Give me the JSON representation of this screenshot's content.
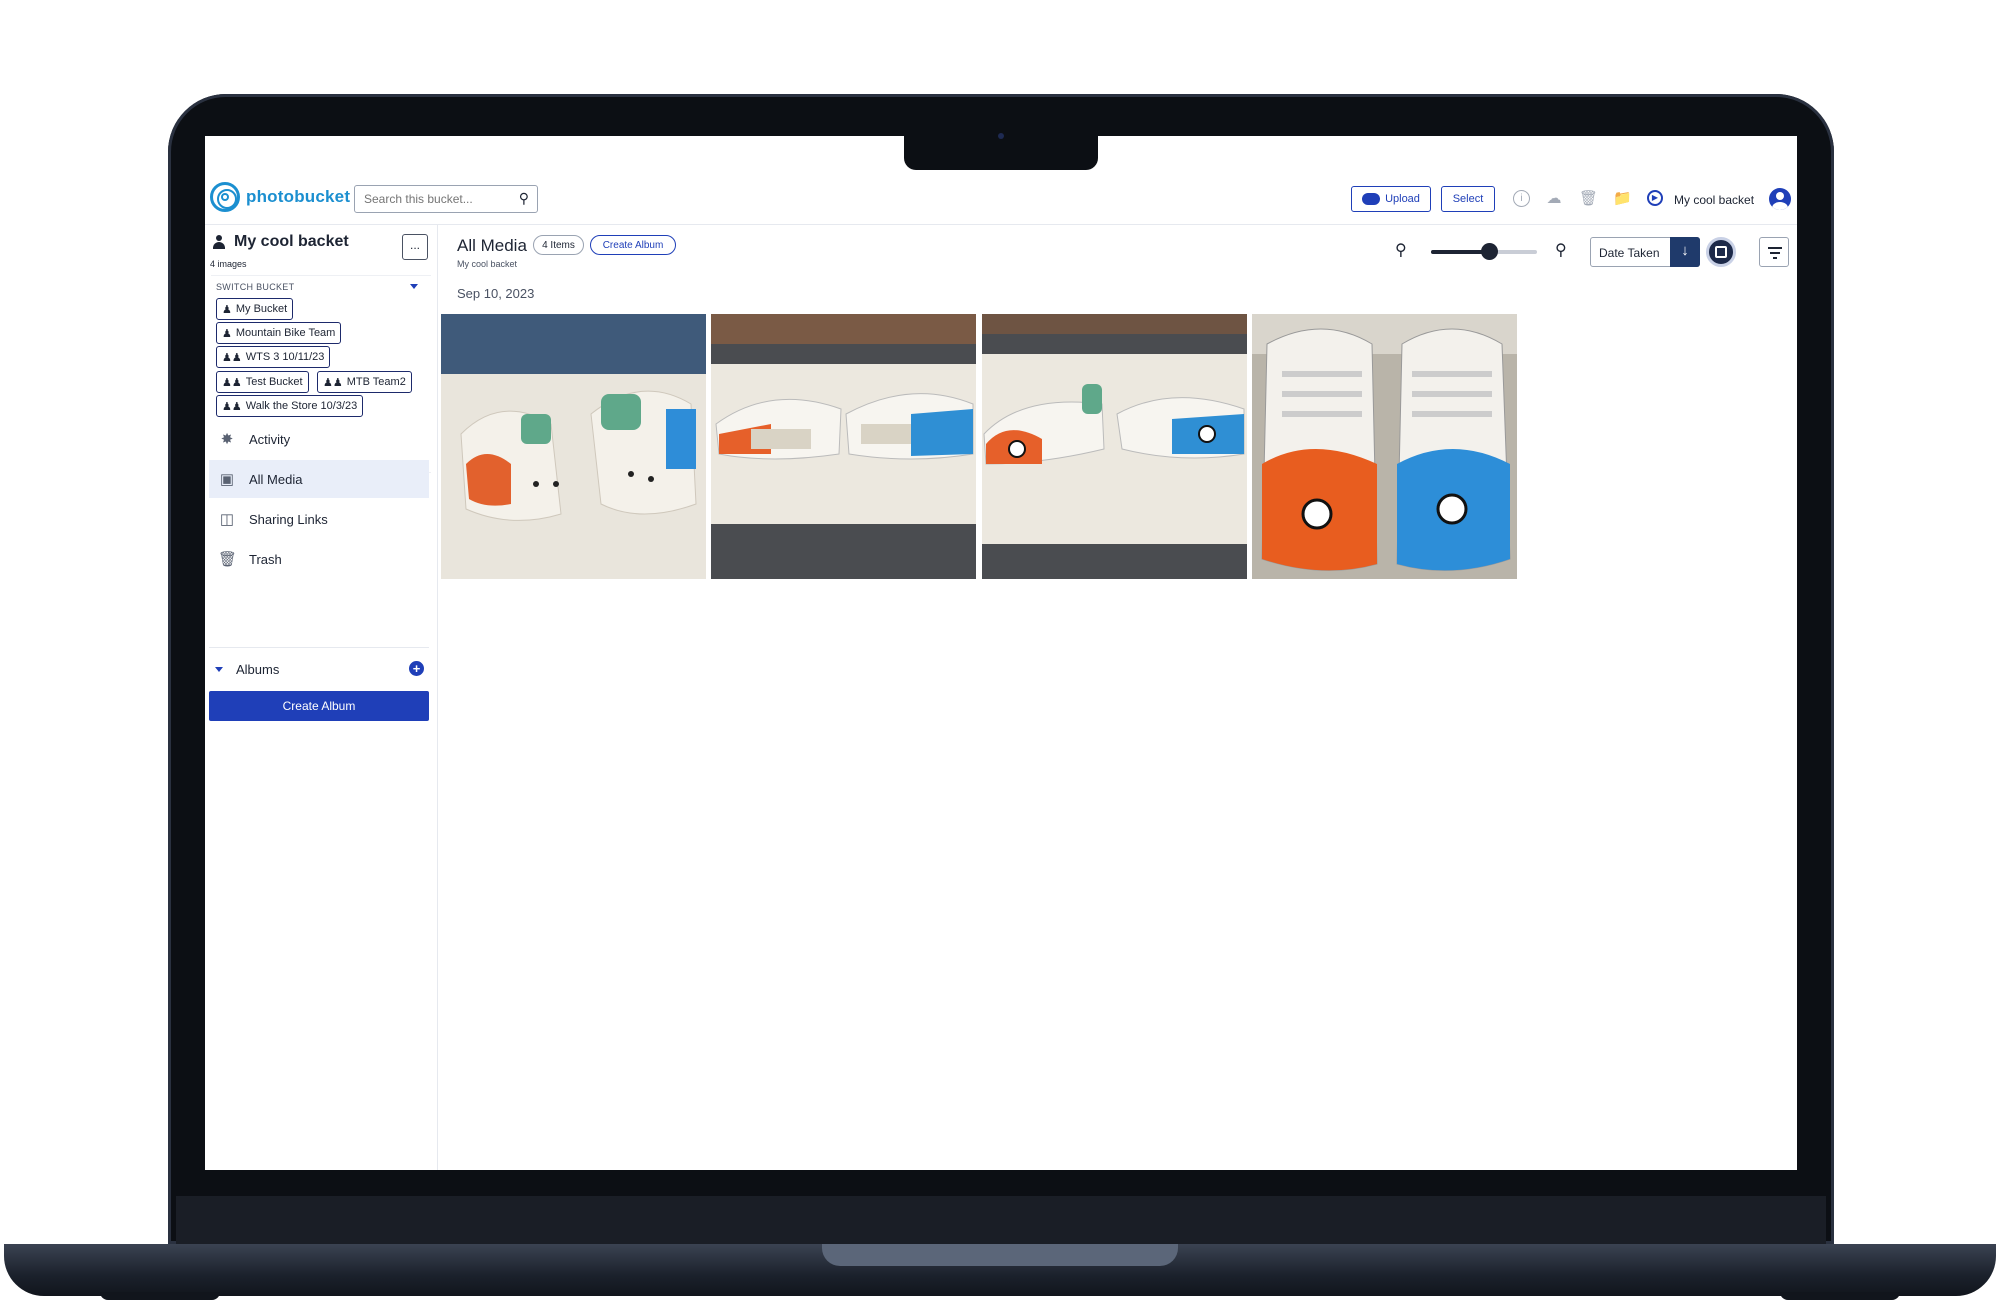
{
  "app": {
    "logo_text": "photobucket",
    "search_placeholder": "Search this bucket...",
    "upload_label": "Upload",
    "select_label": "Select",
    "bucket_name": "My cool backet"
  },
  "sidebar": {
    "title": "My cool backet",
    "image_count": "4 images",
    "more_label": "...",
    "switch_label": "SWITCH BUCKET",
    "buckets": [
      {
        "label": "My Bucket",
        "icon": "person-icon"
      },
      {
        "label": "Mountain Bike Team",
        "icon": "person-icon"
      },
      {
        "label": "WTS 3 10/11/23",
        "icon": "group-icon"
      },
      {
        "label": "Test Bucket",
        "icon": "group-icon"
      },
      {
        "label": "MTB Team2",
        "icon": "group-icon"
      },
      {
        "label": "Walk the Store 10/3/23",
        "icon": "group-icon"
      }
    ],
    "nav": [
      {
        "label": "Activity",
        "icon": "activity-icon"
      },
      {
        "label": "All Media",
        "icon": "media-icon",
        "active": true
      },
      {
        "label": "Sharing Links",
        "icon": "share-icon"
      },
      {
        "label": "Trash",
        "icon": "trash-icon"
      }
    ],
    "albums_label": "Albums",
    "create_album_label": "Create Album"
  },
  "main": {
    "title": "All Media",
    "item_count": "4 Items",
    "create_album_label": "Create Album",
    "subtitle": "My cool backet",
    "sort_label": "Date Taken",
    "zoom_level": 0.55,
    "date_group": "Sep 10, 2023",
    "photos": [
      {
        "alt": "painted sneakers rear view"
      },
      {
        "alt": "painted sneakers side view"
      },
      {
        "alt": "painted sneakers side view toes"
      },
      {
        "alt": "painted sneakers front view"
      }
    ]
  },
  "colors": {
    "accent": "#1f3fb8",
    "brand": "#1b8fd0",
    "text": "#1d2433"
  }
}
